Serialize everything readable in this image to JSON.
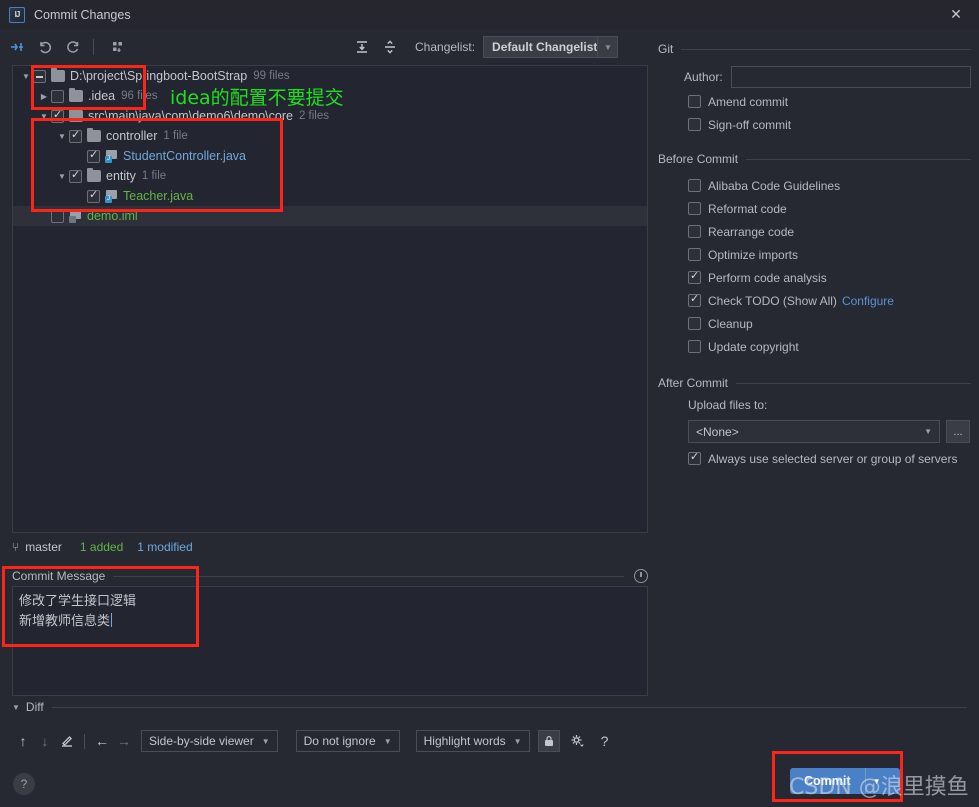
{
  "window": {
    "title": "Commit Changes",
    "app_icon": "intellij-idea-icon",
    "close_label": "✕"
  },
  "toolbar": {
    "icons": [
      {
        "name": "show-diff-icon",
        "glyph": "⤙"
      },
      {
        "name": "revert-icon",
        "glyph": "↺"
      },
      {
        "name": "refresh-icon",
        "glyph": "⟳"
      },
      {
        "name": "group-by-icon",
        "glyph": "⠿"
      }
    ],
    "expand_all_glyph": "⤒",
    "collapse_all_glyph": "⤓",
    "changelist_label": "Changelist:",
    "changelist_value": "Default Changelist",
    "dropdown_arrow": "▼"
  },
  "tree": {
    "rows": [
      {
        "name": "tree-row-root",
        "twisty": "▼",
        "checkbox": "partial",
        "icon": "folder-icon",
        "label": "D:\\project\\Springboot-BootStrap",
        "label_color": "plain",
        "count": "99 files",
        "indent": 0,
        "selected": false
      },
      {
        "name": "tree-row-idea",
        "twisty": "▶",
        "checkbox": "unchecked",
        "icon": "folder-icon",
        "label": ".idea",
        "label_color": "plain",
        "count": "96 files",
        "indent": 1,
        "selected": false
      },
      {
        "name": "tree-row-src-core",
        "twisty": "▼",
        "checkbox": "checked",
        "icon": "folder-icon",
        "label": "src\\main\\java\\com\\demo6\\demo\\core",
        "label_color": "plain",
        "count": "2 files",
        "indent": 1,
        "selected": false
      },
      {
        "name": "tree-row-controller",
        "twisty": "▼",
        "checkbox": "checked",
        "icon": "folder-icon",
        "label": "controller",
        "label_color": "plain",
        "count": "1 file",
        "indent": 2,
        "selected": false
      },
      {
        "name": "tree-row-studentcontroller",
        "twisty": "",
        "checkbox": "checked",
        "icon": "java-class-icon",
        "label": "StudentController.java",
        "label_color": "blue",
        "count": "",
        "indent": 3,
        "selected": false
      },
      {
        "name": "tree-row-entity",
        "twisty": "▼",
        "checkbox": "checked",
        "icon": "folder-icon",
        "label": "entity",
        "label_color": "plain",
        "count": "1 file",
        "indent": 2,
        "selected": false
      },
      {
        "name": "tree-row-teacher",
        "twisty": "",
        "checkbox": "checked",
        "icon": "java-class-icon",
        "label": "Teacher.java",
        "label_color": "green",
        "count": "",
        "indent": 3,
        "selected": false
      },
      {
        "name": "tree-row-demo-iml",
        "twisty": "",
        "checkbox": "unchecked",
        "icon": "iml-file-icon",
        "label": "demo.iml",
        "label_color": "green",
        "count": "",
        "indent": 1,
        "selected": true
      }
    ]
  },
  "status": {
    "branch_icon": "git-branch-icon",
    "branch": "master",
    "added": "1 added",
    "modified": "1 modified"
  },
  "commit_message": {
    "header": "Commit Message",
    "header_mnemonic": "C",
    "history_icon": "clock-icon",
    "line1": "修改了学生接口逻辑",
    "line2": "新增教师信息类"
  },
  "diff": {
    "twisty": "▼",
    "header": "Diff",
    "prev_glyph": "↑",
    "next_glyph": "↓",
    "edit_glyph": "✎",
    "left_glyph": "←",
    "right_glyph": "→",
    "viewer_mode": "Side-by-side viewer",
    "ignore_mode": "Do not ignore",
    "highlight_mode": "Highlight words",
    "lock_glyph": "🔒",
    "settings_glyph": "⚙",
    "help_glyph": "?",
    "arrow": "▼"
  },
  "right_panel": {
    "git": {
      "header": "Git",
      "author_label": "Author:",
      "author_mnemonic": "A",
      "author_value": "",
      "checkboxes": [
        {
          "name": "amend-commit-checkbox",
          "label": "Amend commit",
          "mnemonic": "m",
          "checked": false
        },
        {
          "name": "sign-off-commit-checkbox",
          "label": "Sign-off commit",
          "mnemonic": "g",
          "checked": false
        }
      ]
    },
    "before_commit": {
      "header": "Before Commit",
      "checkboxes": [
        {
          "name": "alibaba-code-guidelines-checkbox",
          "label": "Alibaba Code Guidelines",
          "checked": false,
          "link": ""
        },
        {
          "name": "reformat-code-checkbox",
          "label": "Reformat code",
          "mnemonic": "R",
          "checked": false,
          "link": ""
        },
        {
          "name": "rearrange-code-checkbox",
          "label": "Rearrange code",
          "mnemonic": "n",
          "checked": false,
          "link": ""
        },
        {
          "name": "optimize-imports-checkbox",
          "label": "Optimize imports",
          "mnemonic": "O",
          "checked": false,
          "link": ""
        },
        {
          "name": "perform-code-analysis-checkbox",
          "label": "Perform code analysis",
          "mnemonic": "y",
          "checked": true,
          "link": ""
        },
        {
          "name": "check-todo-checkbox",
          "label": "Check TODO (Show All)",
          "checked": true,
          "link": "Configure"
        },
        {
          "name": "cleanup-checkbox",
          "label": "Cleanup",
          "mnemonic": "l",
          "checked": false,
          "link": ""
        },
        {
          "name": "update-copyright-checkbox",
          "label": "Update copyright",
          "checked": false,
          "link": ""
        }
      ]
    },
    "after_commit": {
      "header": "After Commit",
      "upload_label": "Upload files to:",
      "upload_value": "<None>",
      "browse_label": "...",
      "always_use_label": "Always use selected server or group of servers",
      "always_use_checked": true
    }
  },
  "footer": {
    "help_glyph": "?",
    "commit_label": "Commit",
    "commit_arrow": "▼"
  },
  "annotations": {
    "note_idea": "idea的配置不要提交",
    "watermark": "CSDN @浪里摸鱼",
    "highlight_color": "#fb2617",
    "note_color": "#1fe01f"
  },
  "colors": {
    "background": "#262931",
    "titlebar": "#25262e",
    "panel": "#232630",
    "accent": "#4a80c6",
    "added": "#62b543",
    "modified": "#6fa8dc"
  }
}
